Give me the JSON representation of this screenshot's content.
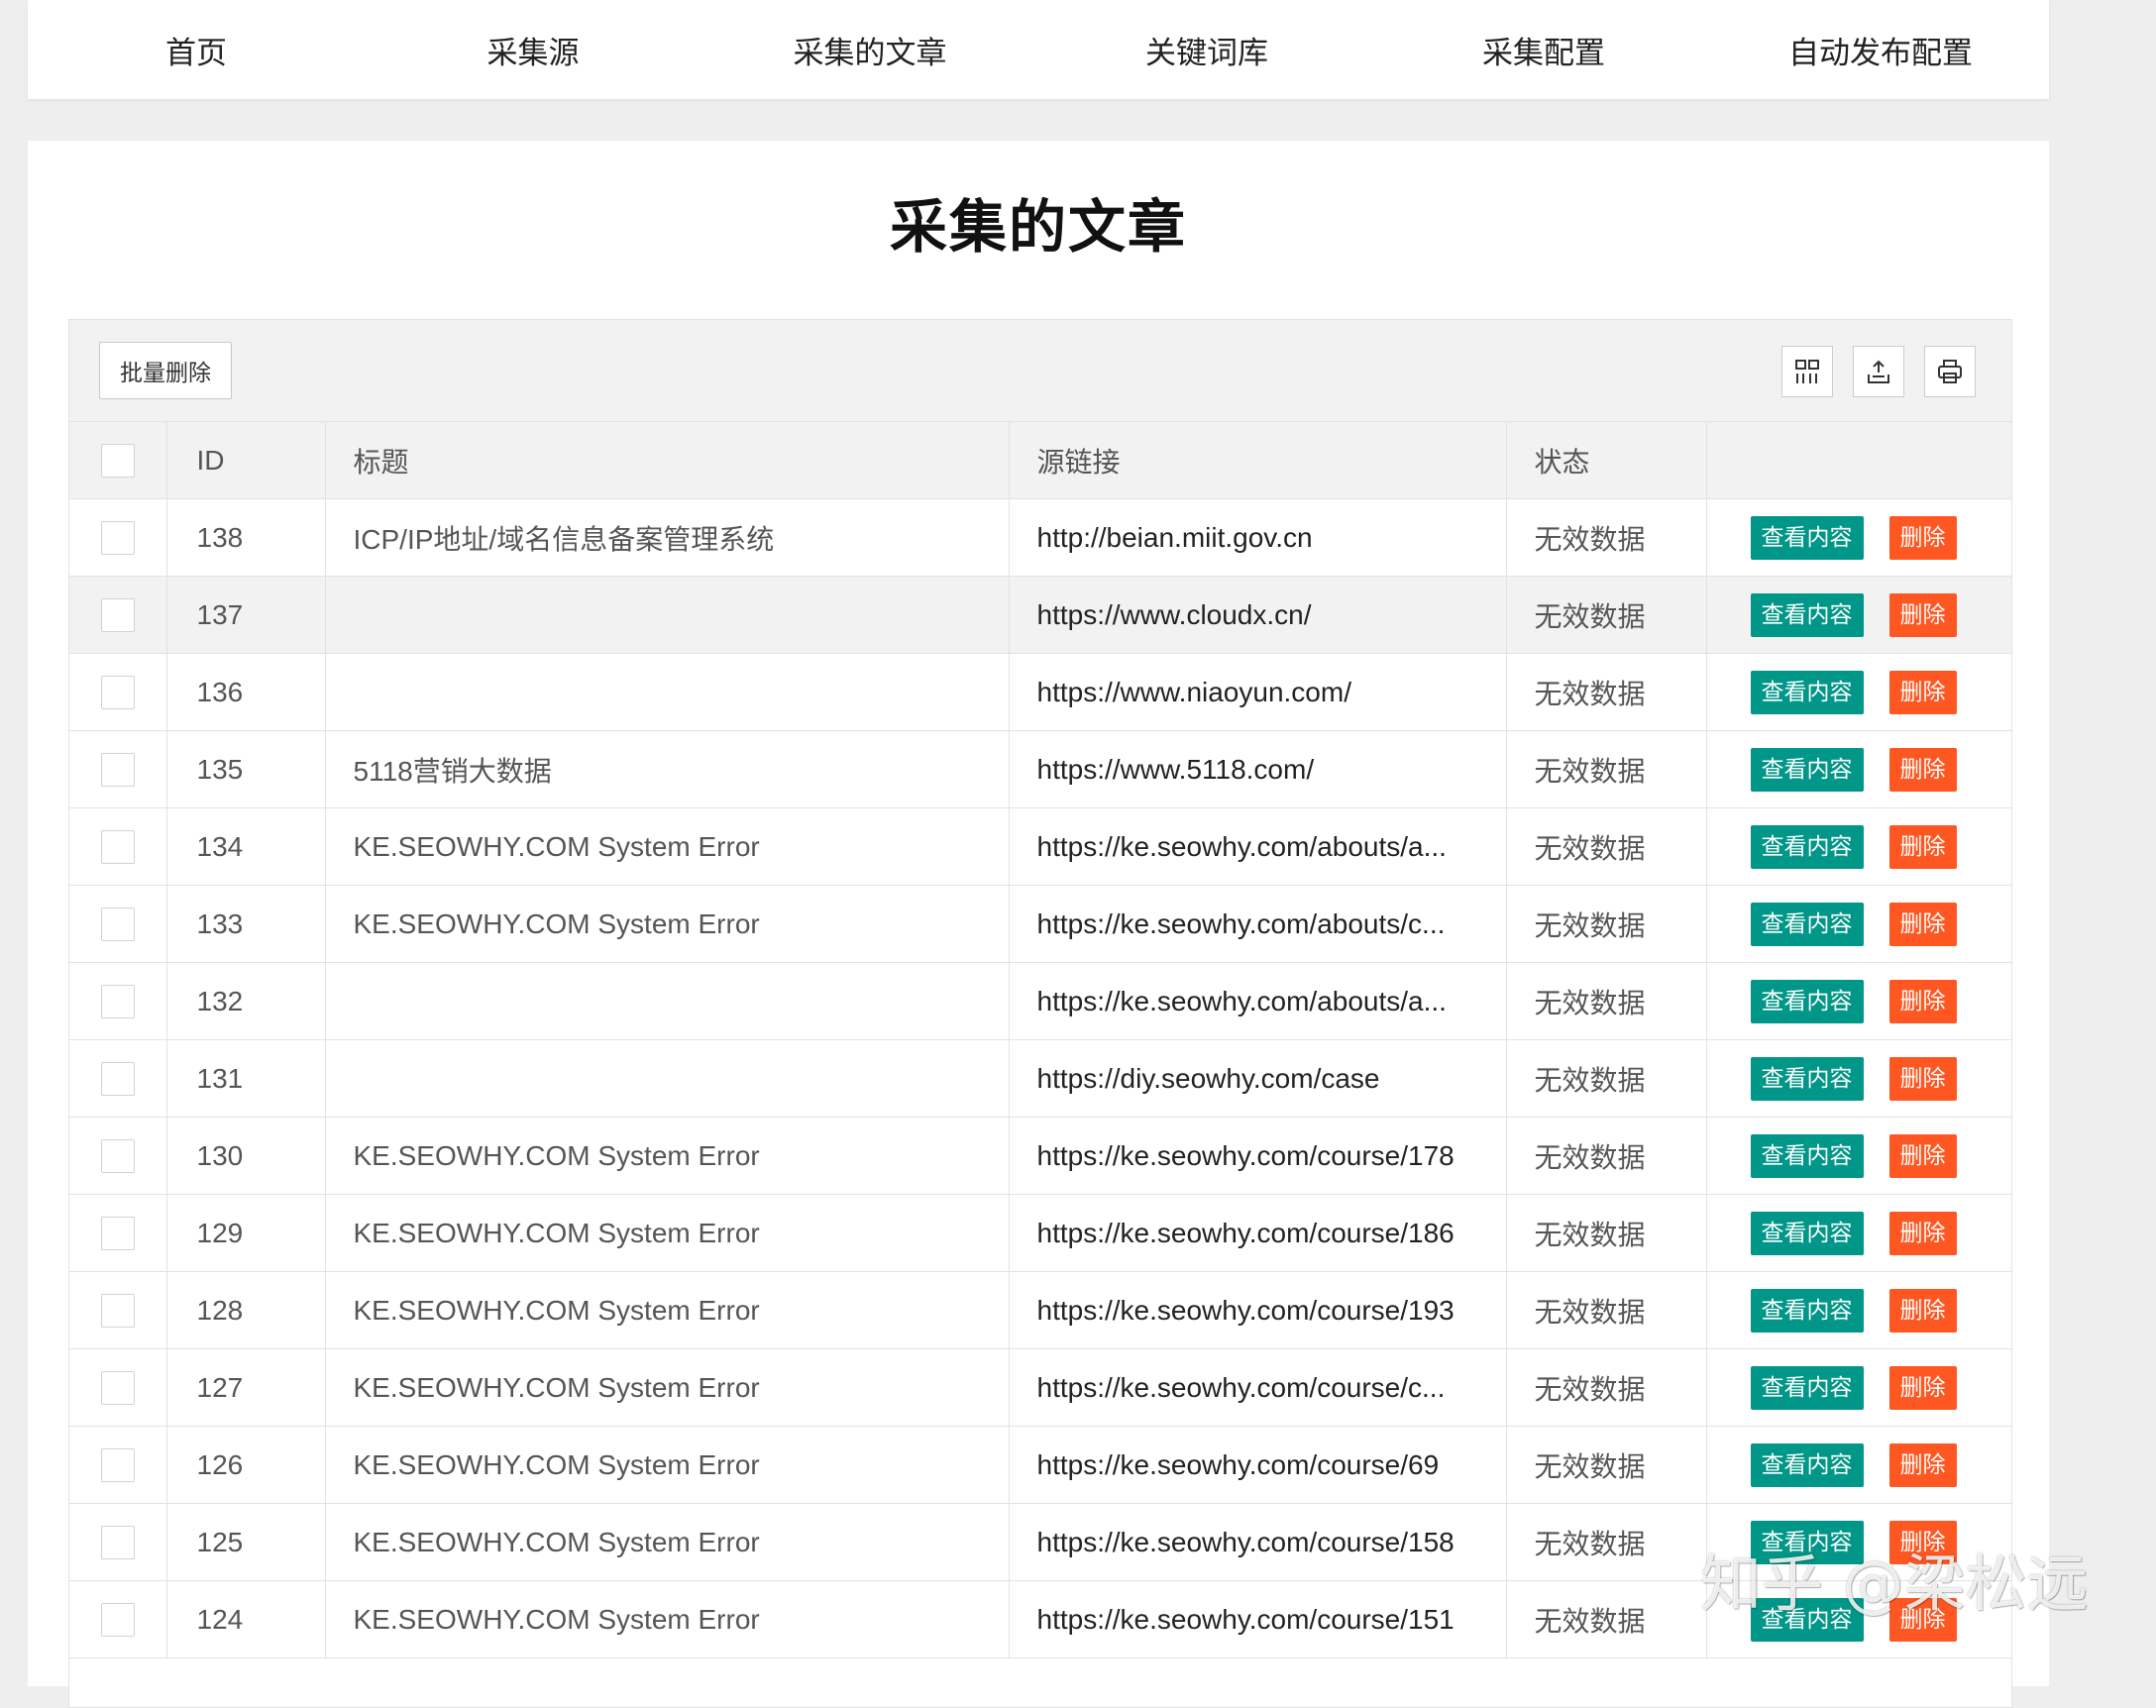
{
  "nav": {
    "items": [
      "首页",
      "采集源",
      "采集的文章",
      "关键词库",
      "采集配置",
      "自动发布配置"
    ]
  },
  "page": {
    "title": "采集的文章"
  },
  "toolbar": {
    "batch_delete_label": "批量删除",
    "icons": [
      "columns-icon",
      "export-icon",
      "print-icon"
    ]
  },
  "table": {
    "headers": {
      "id": "ID",
      "title": "标题",
      "link": "源链接",
      "status": "状态",
      "actions": ""
    },
    "view_label": "查看内容",
    "delete_label": "删除",
    "rows": [
      {
        "id": "138",
        "title": "ICP/IP地址/域名信息备案管理系统",
        "link": "http://beian.miit.gov.cn",
        "status": "无效数据"
      },
      {
        "id": "137",
        "title": "",
        "link": "https://www.cloudx.cn/",
        "status": "无效数据"
      },
      {
        "id": "136",
        "title": "",
        "link": "https://www.niaoyun.com/",
        "status": "无效数据"
      },
      {
        "id": "135",
        "title": "5118营销大数据",
        "link": "https://www.5118.com/",
        "status": "无效数据"
      },
      {
        "id": "134",
        "title": "KE.SEOWHY.COM System Error",
        "link": "https://ke.seowhy.com/abouts/a...",
        "status": "无效数据"
      },
      {
        "id": "133",
        "title": "KE.SEOWHY.COM System Error",
        "link": "https://ke.seowhy.com/abouts/c...",
        "status": "无效数据"
      },
      {
        "id": "132",
        "title": "",
        "link": "https://ke.seowhy.com/abouts/a...",
        "status": "无效数据"
      },
      {
        "id": "131",
        "title": "",
        "link": "https://diy.seowhy.com/case",
        "status": "无效数据"
      },
      {
        "id": "130",
        "title": "KE.SEOWHY.COM System Error",
        "link": "https://ke.seowhy.com/course/178",
        "status": "无效数据"
      },
      {
        "id": "129",
        "title": "KE.SEOWHY.COM System Error",
        "link": "https://ke.seowhy.com/course/186",
        "status": "无效数据"
      },
      {
        "id": "128",
        "title": "KE.SEOWHY.COM System Error",
        "link": "https://ke.seowhy.com/course/193",
        "status": "无效数据"
      },
      {
        "id": "127",
        "title": "KE.SEOWHY.COM System Error",
        "link": "https://ke.seowhy.com/course/c...",
        "status": "无效数据"
      },
      {
        "id": "126",
        "title": "KE.SEOWHY.COM System Error",
        "link": "https://ke.seowhy.com/course/69",
        "status": "无效数据"
      },
      {
        "id": "125",
        "title": "KE.SEOWHY.COM System Error",
        "link": "https://ke.seowhy.com/course/158",
        "status": "无效数据"
      },
      {
        "id": "124",
        "title": "KE.SEOWHY.COM System Error",
        "link": "https://ke.seowhy.com/course/151",
        "status": "无效数据"
      }
    ]
  },
  "watermark": "知乎 @梁松远",
  "colors": {
    "view_button": "#009688",
    "delete_button": "#ff5722",
    "header_bg": "#f2f2f2"
  }
}
